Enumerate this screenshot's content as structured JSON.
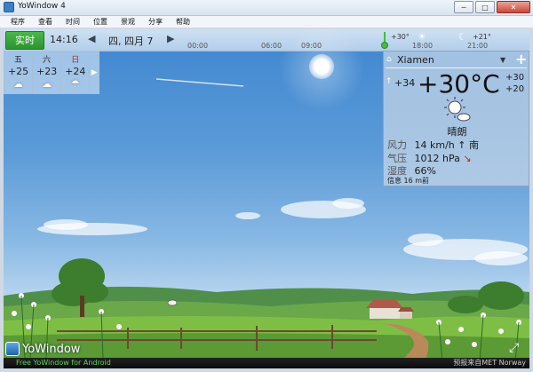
{
  "window": {
    "title": "YoWindow 4",
    "minimize": "─",
    "maximize": "□",
    "close": "✕"
  },
  "menu": [
    "程序",
    "查看",
    "时间",
    "位置",
    "景观",
    "分享",
    "帮助"
  ],
  "timeline": {
    "realtime_label": "实时",
    "time": "14:16",
    "prev_arrow": "◀",
    "date": "四, 四月 7",
    "next_arrow": "▶",
    "ticks": [
      "00:00",
      "06:00",
      "09:00",
      "18:00",
      "21:00"
    ],
    "temp_high": "+30°",
    "temp_low": "+21°"
  },
  "forecast": {
    "days": [
      {
        "name": "五",
        "temp": "+25",
        "icon": "partly-cloudy-icon",
        "glyph": "☁"
      },
      {
        "name": "六",
        "temp": "+23",
        "icon": "cloudy-icon",
        "glyph": "☁"
      },
      {
        "name": "日",
        "temp": "+24",
        "icon": "rain-icon",
        "glyph": "☂"
      }
    ],
    "more_arrow": "▶"
  },
  "current": {
    "home_icon": "⌂",
    "city": "Xiamen",
    "dropdown": "▼",
    "add": "+",
    "feels_like_arrow": "↑",
    "feels_like": "+34",
    "temperature": "+30°C",
    "high": "+30",
    "low": "+20",
    "condition": "晴朗",
    "wind_label": "风力",
    "wind_value": "14 km/h",
    "wind_arrow": "↑",
    "wind_dir": "南",
    "pressure_label": "气压",
    "pressure_value": "1012 hPa",
    "pressure_arrow": "↘",
    "humidity_label": "湿度",
    "humidity_value": "66%",
    "updated": "信息 16 m前"
  },
  "bottom": {
    "logo": "YoWindow",
    "promo": "Free YoWindow for Android",
    "credit": "预报来自MET Norway",
    "fullscreen": "⤢"
  },
  "colors": {
    "accent_green": "#2d9330",
    "sky": "#4f90d4",
    "sunday_red": "#c0231b"
  }
}
